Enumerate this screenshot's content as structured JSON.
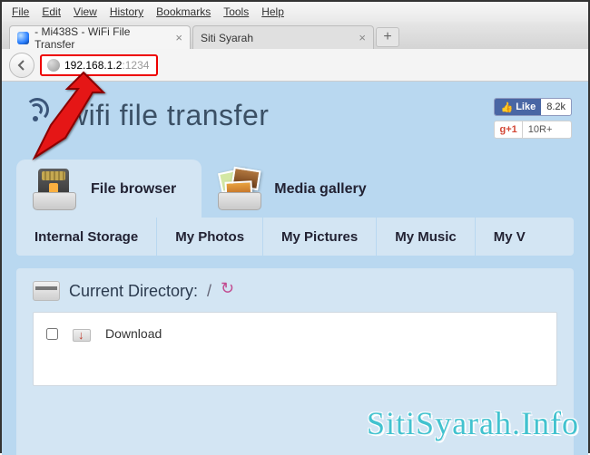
{
  "browser": {
    "menu": {
      "file": "File",
      "edit": "Edit",
      "view": "View",
      "history": "History",
      "bookmarks": "Bookmarks",
      "tools": "Tools",
      "help": "Help"
    },
    "tabs": [
      {
        "label": "- Mi438S - WiFi File Transfer"
      },
      {
        "label": "Siti Syarah"
      }
    ],
    "url_host": "192.168.1.2",
    "url_port": ":1234"
  },
  "page": {
    "title": "wifi file transfer",
    "social": {
      "fb_like": "Like",
      "fb_count": "8.2k",
      "gp_label": "+1",
      "gp_count": "10R+"
    },
    "apptabs": [
      {
        "label": "File browser"
      },
      {
        "label": "Media gallery"
      }
    ],
    "storage": [
      "Internal Storage",
      "My Photos",
      "My Pictures",
      "My Music",
      "My V"
    ],
    "curdir_label": "Current Directory:",
    "curdir_path": "/",
    "rows": [
      {
        "name": "Download"
      }
    ]
  },
  "watermark": "SitiSyarah.Info"
}
